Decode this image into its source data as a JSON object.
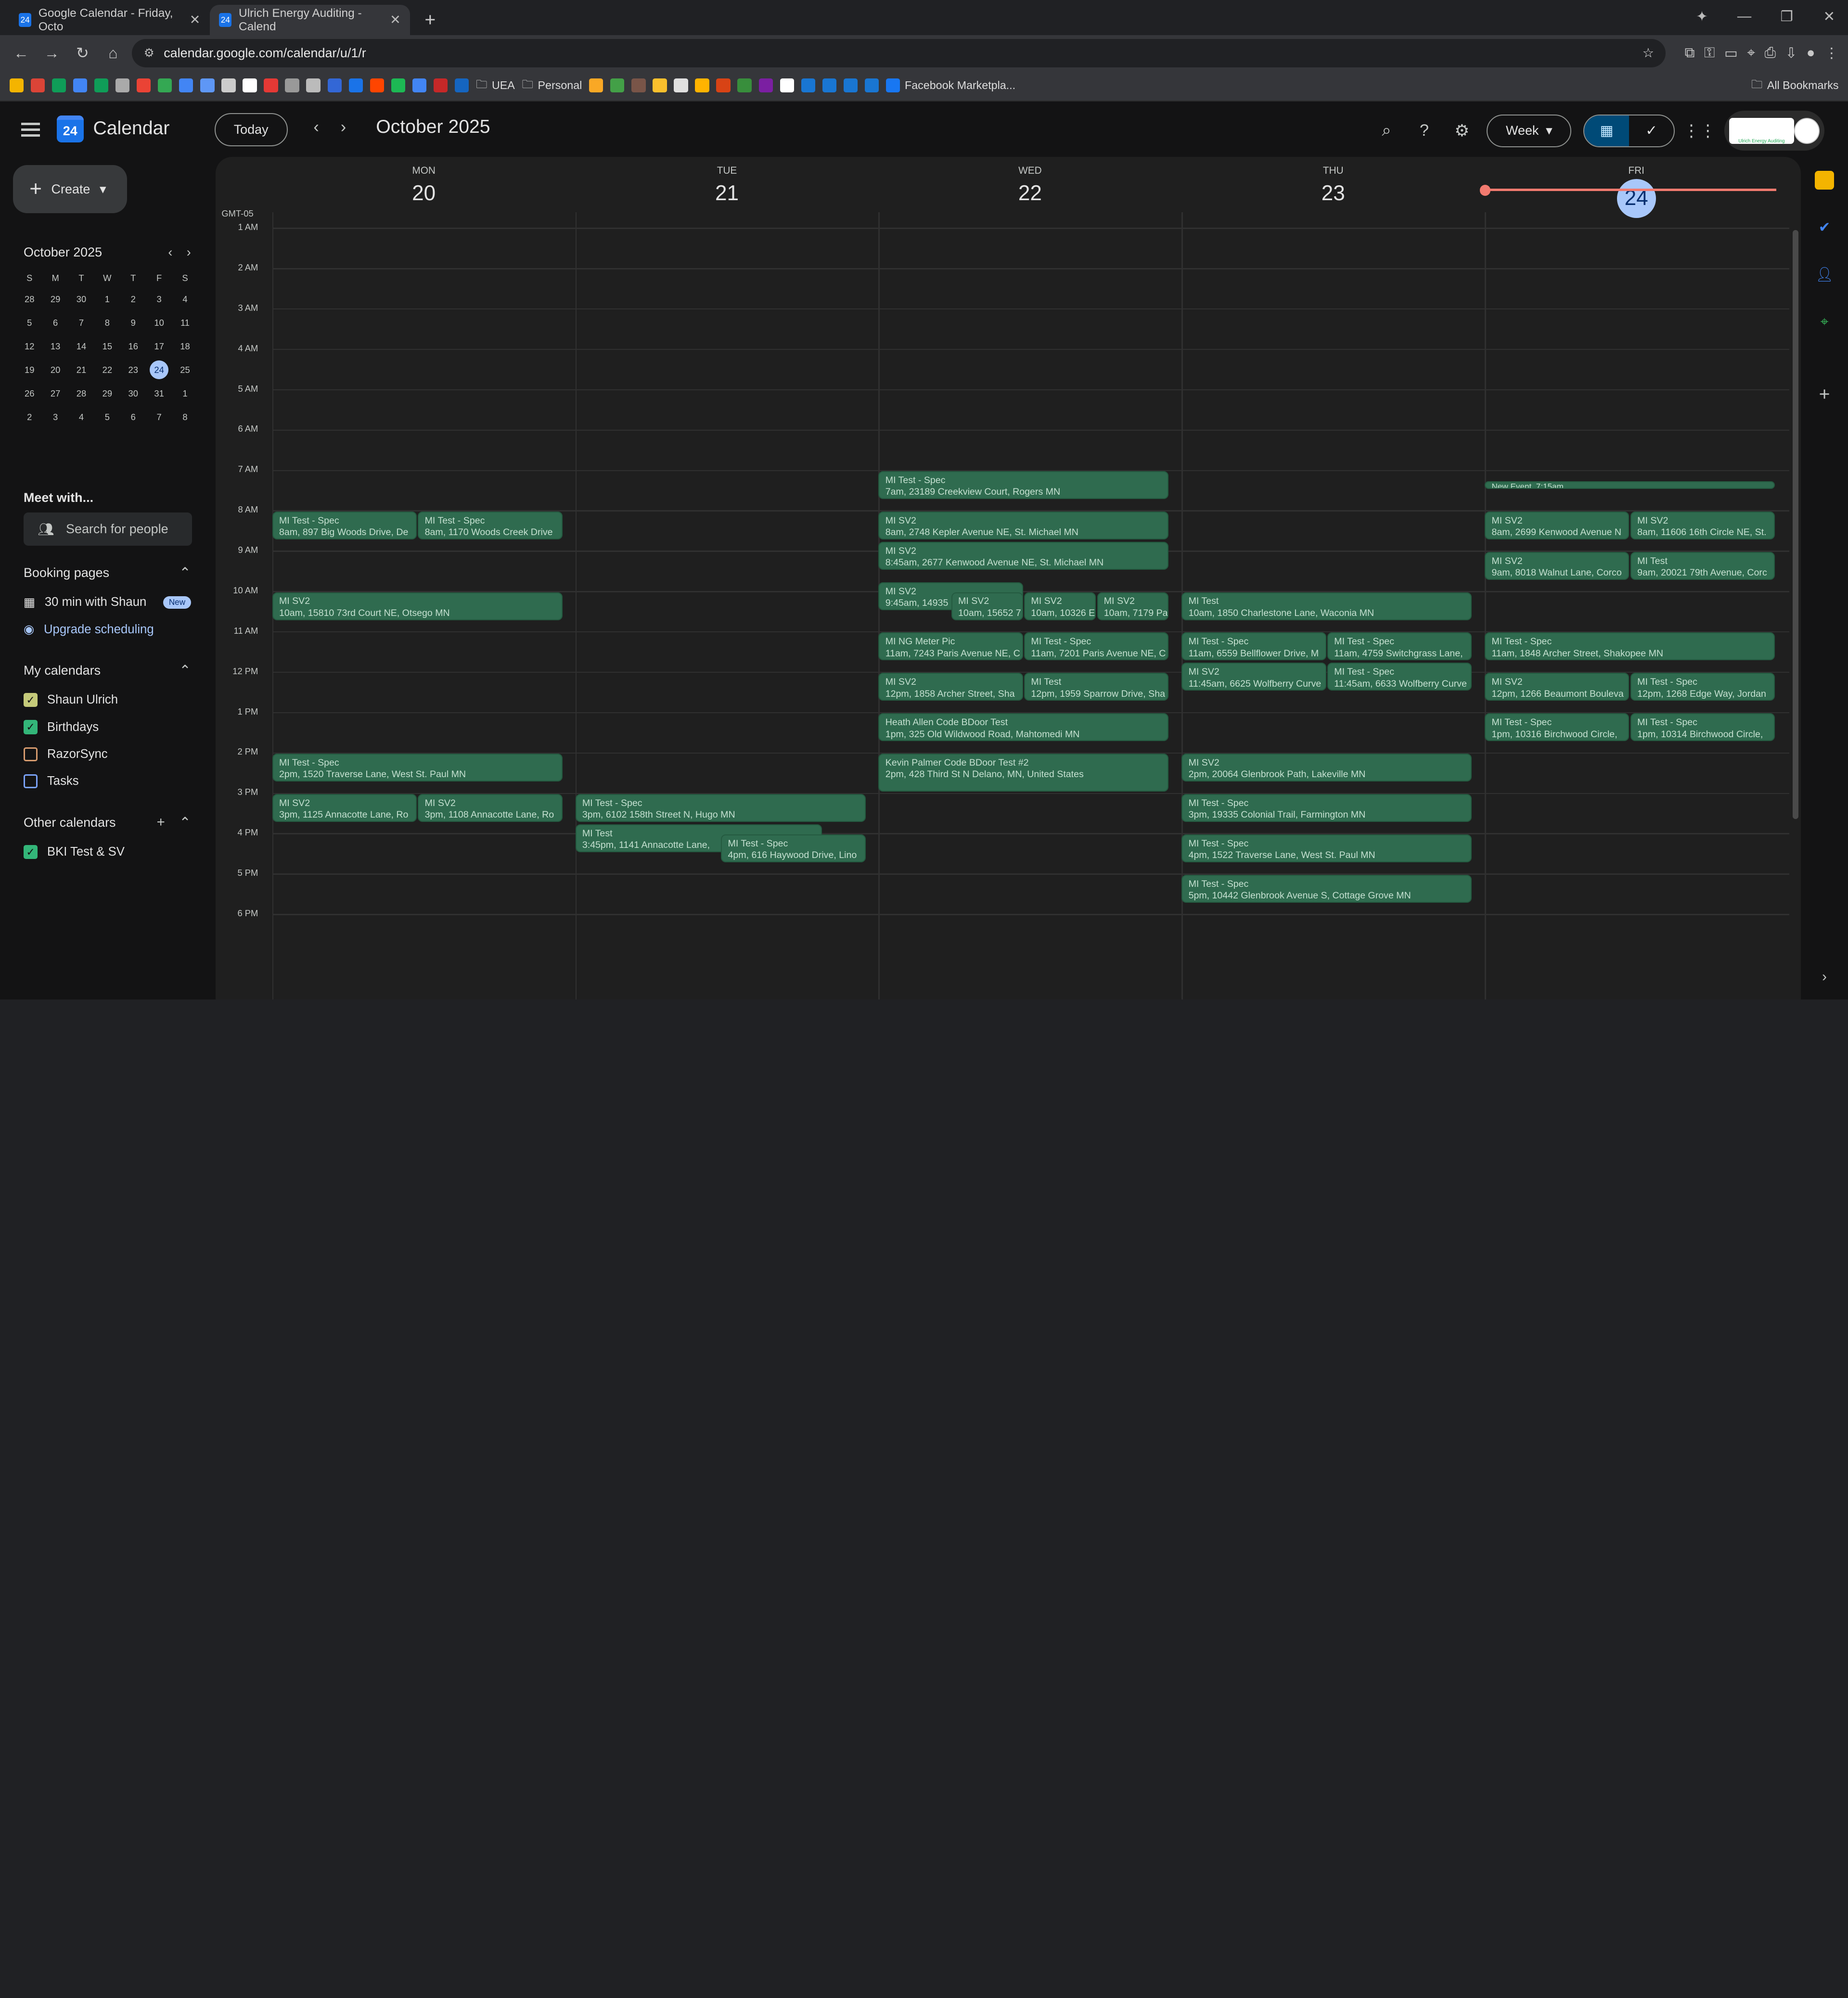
{
  "browser": {
    "tabs": [
      {
        "label": "Google Calendar - Friday, Octo",
        "active": false
      },
      {
        "label": "Ulrich Energy Auditing - Calend",
        "active": true
      }
    ],
    "url": "calendar.google.com/calendar/u/1/r",
    "bookmarks": [
      {
        "label": "UEA"
      },
      {
        "label": "Personal"
      },
      {
        "label": "Facebook Marketpla..."
      }
    ],
    "all_bookmarks": "All Bookmarks"
  },
  "app": {
    "title": "Calendar",
    "logo_text": "24",
    "today_label": "Today",
    "month_title": "October 2025",
    "view_label": "Week",
    "brand_logo_text": "Ulrich Energy Auditing"
  },
  "sidebar": {
    "create_label": "Create",
    "mini_month": "October 2025",
    "dow": [
      "S",
      "M",
      "T",
      "W",
      "T",
      "F",
      "S"
    ],
    "weeks": [
      [
        "28",
        "29",
        "30",
        "1",
        "2",
        "3",
        "4"
      ],
      [
        "5",
        "6",
        "7",
        "8",
        "9",
        "10",
        "11"
      ],
      [
        "12",
        "13",
        "14",
        "15",
        "16",
        "17",
        "18"
      ],
      [
        "19",
        "20",
        "21",
        "22",
        "23",
        "24",
        "25"
      ],
      [
        "26",
        "27",
        "28",
        "29",
        "30",
        "31",
        "1"
      ],
      [
        "2",
        "3",
        "4",
        "5",
        "6",
        "7",
        "8"
      ]
    ],
    "selected_day": "24",
    "meet_with": "Meet with...",
    "search_people": "Search for people",
    "booking_pages": "Booking pages",
    "booking_item": "30 min with Shaun",
    "new_badge": "New",
    "upgrade": "Upgrade scheduling",
    "my_calendars": "My calendars",
    "calendars": [
      {
        "label": "Shaun Ulrich",
        "checked": true,
        "color": "#c5ca7a"
      },
      {
        "label": "Birthdays",
        "checked": true,
        "color": "#33b679"
      },
      {
        "label": "RazorSync",
        "checked": false,
        "color": "#d79b6e"
      },
      {
        "label": "Tasks",
        "checked": false,
        "color": "#7aa2f7"
      }
    ],
    "other_calendars": "Other calendars",
    "others": [
      {
        "label": "BKI Test & SV",
        "checked": true,
        "color": "#33b679"
      }
    ]
  },
  "grid": {
    "timezone": "GMT-05",
    "days": [
      {
        "dow": "MON",
        "num": "20"
      },
      {
        "dow": "TUE",
        "num": "21"
      },
      {
        "dow": "WED",
        "num": "22"
      },
      {
        "dow": "THU",
        "num": "23"
      },
      {
        "dow": "FRI",
        "num": "24",
        "today": true
      }
    ],
    "hours": [
      "1 AM",
      "2 AM",
      "3 AM",
      "4 AM",
      "5 AM",
      "6 AM",
      "7 AM",
      "8 AM",
      "9 AM",
      "10 AM",
      "11 AM",
      "12 PM",
      "1 PM",
      "2 PM",
      "3 PM",
      "4 PM",
      "5 PM",
      "6 PM"
    ],
    "events": [
      {
        "day": 0,
        "start": 8,
        "dur": 0.75,
        "col": 0,
        "cols": 2,
        "title": "MI Test - Spec",
        "sub": "8am, 897 Big Woods Drive, De"
      },
      {
        "day": 0,
        "start": 8,
        "dur": 0.75,
        "col": 1,
        "cols": 2,
        "title": "MI Test - Spec",
        "sub": "8am, 1170 Woods Creek Drive"
      },
      {
        "day": 0,
        "start": 10,
        "dur": 0.75,
        "col": 0,
        "cols": 1,
        "title": "MI SV2",
        "sub": "10am, 15810 73rd Court NE, Otsego MN"
      },
      {
        "day": 0,
        "start": 14,
        "dur": 0.75,
        "col": 0,
        "cols": 1,
        "title": "MI Test - Spec",
        "sub": "2pm, 1520 Traverse Lane, West St. Paul MN"
      },
      {
        "day": 0,
        "start": 15,
        "dur": 0.75,
        "col": 0,
        "cols": 2,
        "title": "MI SV2",
        "sub": "3pm, 1125 Annacotte Lane, Ro"
      },
      {
        "day": 0,
        "start": 15,
        "dur": 0.75,
        "col": 1,
        "cols": 2,
        "title": "MI SV2",
        "sub": "3pm, 1108 Annacotte Lane, Ro"
      },
      {
        "day": 1,
        "start": 15,
        "dur": 0.75,
        "col": 0,
        "cols": 1,
        "title": "MI Test - Spec",
        "sub": "3pm, 6102 158th Street N, Hugo MN"
      },
      {
        "day": 1,
        "start": 15.75,
        "dur": 0.75,
        "col": 0,
        "cols": 1,
        "w": 0.85,
        "title": "MI Test",
        "sub": "3:45pm, 1141 Annacotte Lane,"
      },
      {
        "day": 1,
        "start": 16,
        "dur": 0.75,
        "col": 1,
        "cols": 2,
        "title": "MI Test - Spec",
        "sub": "4pm, 616 Haywood Drive, Lino"
      },
      {
        "day": 2,
        "start": 7,
        "dur": 0.75,
        "col": 0,
        "cols": 1,
        "title": "MI Test - Spec",
        "sub": "7am, 23189 Creekview Court, Rogers MN"
      },
      {
        "day": 2,
        "start": 8,
        "dur": 0.75,
        "col": 0,
        "cols": 1,
        "title": "MI SV2",
        "sub": "8am, 2748 Kepler Avenue NE, St. Michael MN"
      },
      {
        "day": 2,
        "start": 8.75,
        "dur": 0.75,
        "col": 0,
        "cols": 1,
        "title": "MI SV2",
        "sub": "8:45am, 2677 Kenwood Avenue NE, St. Michael MN"
      },
      {
        "day": 2,
        "start": 9.75,
        "dur": 0.75,
        "col": 0,
        "cols": 2,
        "title": "MI SV2",
        "sub": "9:45am, 14935"
      },
      {
        "day": 2,
        "start": 10,
        "dur": 0.75,
        "col": 1,
        "cols": 4,
        "title": "MI SV2",
        "sub": "10am, 15652 7"
      },
      {
        "day": 2,
        "start": 10,
        "dur": 0.75,
        "col": 2,
        "cols": 4,
        "title": "MI SV2",
        "sub": "10am, 10326 E"
      },
      {
        "day": 2,
        "start": 10,
        "dur": 0.75,
        "col": 3,
        "cols": 4,
        "title": "MI SV2",
        "sub": "10am, 7179 Pa"
      },
      {
        "day": 2,
        "start": 11,
        "dur": 0.75,
        "col": 0,
        "cols": 2,
        "title": "MI NG Meter Pic",
        "sub": "11am, 7243 Paris Avenue NE, C"
      },
      {
        "day": 2,
        "start": 11,
        "dur": 0.75,
        "col": 1,
        "cols": 2,
        "title": "MI Test - Spec",
        "sub": "11am, 7201 Paris Avenue NE, C"
      },
      {
        "day": 2,
        "start": 12,
        "dur": 0.75,
        "col": 0,
        "cols": 2,
        "title": "MI SV2",
        "sub": "12pm, 1858 Archer Street, Sha"
      },
      {
        "day": 2,
        "start": 12,
        "dur": 0.75,
        "col": 1,
        "cols": 2,
        "title": "MI Test",
        "sub": "12pm, 1959 Sparrow Drive, Sha"
      },
      {
        "day": 2,
        "start": 13,
        "dur": 0.75,
        "col": 0,
        "cols": 1,
        "title": "Heath Allen Code BDoor Test",
        "sub": "1pm, 325 Old Wildwood Road, Mahtomedi MN"
      },
      {
        "day": 2,
        "start": 14,
        "dur": 1,
        "col": 0,
        "cols": 1,
        "title": "Kevin Palmer Code BDoor Test #2",
        "sub": "2pm, 428 Third St N Delano, MN, United States"
      },
      {
        "day": 3,
        "start": 10,
        "dur": 0.75,
        "col": 0,
        "cols": 1,
        "title": "MI Test",
        "sub": "10am, 1850 Charlestone Lane, Waconia MN"
      },
      {
        "day": 3,
        "start": 11,
        "dur": 0.75,
        "col": 0,
        "cols": 2,
        "title": "MI Test - Spec",
        "sub": "11am, 6559 Bellflower Drive, M"
      },
      {
        "day": 3,
        "start": 11,
        "dur": 0.75,
        "col": 1,
        "cols": 2,
        "title": "MI Test - Spec",
        "sub": "11am, 4759 Switchgrass Lane,"
      },
      {
        "day": 3,
        "start": 11.75,
        "dur": 0.75,
        "col": 0,
        "cols": 2,
        "title": "MI SV2",
        "sub": "11:45am, 6625 Wolfberry Curve"
      },
      {
        "day": 3,
        "start": 11.75,
        "dur": 0.75,
        "col": 1,
        "cols": 2,
        "title": "MI Test - Spec",
        "sub": "11:45am, 6633 Wolfberry Curve"
      },
      {
        "day": 3,
        "start": 14,
        "dur": 0.75,
        "col": 0,
        "cols": 1,
        "title": "MI SV2",
        "sub": "2pm, 20064 Glenbrook Path, Lakeville MN"
      },
      {
        "day": 3,
        "start": 15,
        "dur": 0.75,
        "col": 0,
        "cols": 1,
        "title": "MI Test - Spec",
        "sub": "3pm, 19335 Colonial Trail, Farmington MN"
      },
      {
        "day": 3,
        "start": 16,
        "dur": 0.75,
        "col": 0,
        "cols": 1,
        "title": "MI Test - Spec",
        "sub": "4pm, 1522 Traverse Lane, West St. Paul MN"
      },
      {
        "day": 3,
        "start": 17,
        "dur": 0.75,
        "col": 0,
        "cols": 1,
        "title": "MI Test - Spec",
        "sub": "5pm, 10442 Glenbrook Avenue S, Cottage Grove MN"
      },
      {
        "day": 4,
        "start": 7.25,
        "dur": 0.25,
        "col": 0,
        "cols": 1,
        "thin": true,
        "title": "New Event, 7:15am",
        "sub": ""
      },
      {
        "day": 4,
        "start": 8,
        "dur": 0.75,
        "col": 0,
        "cols": 2,
        "title": "MI SV2",
        "sub": "8am, 2699 Kenwood Avenue N"
      },
      {
        "day": 4,
        "start": 8,
        "dur": 0.75,
        "col": 1,
        "cols": 2,
        "title": "MI SV2",
        "sub": "8am, 11606 16th Circle NE, St."
      },
      {
        "day": 4,
        "start": 9,
        "dur": 0.75,
        "col": 0,
        "cols": 2,
        "title": "MI SV2",
        "sub": "9am, 8018 Walnut Lane, Corco"
      },
      {
        "day": 4,
        "start": 9,
        "dur": 0.75,
        "col": 1,
        "cols": 2,
        "title": "MI Test",
        "sub": "9am, 20021 79th Avenue, Corc"
      },
      {
        "day": 4,
        "start": 11,
        "dur": 0.75,
        "col": 0,
        "cols": 1,
        "title": "MI Test - Spec",
        "sub": "11am, 1848 Archer Street, Shakopee MN"
      },
      {
        "day": 4,
        "start": 12,
        "dur": 0.75,
        "col": 0,
        "cols": 2,
        "title": "MI SV2",
        "sub": "12pm, 1266 Beaumont Bouleva"
      },
      {
        "day": 4,
        "start": 12,
        "dur": 0.75,
        "col": 1,
        "cols": 2,
        "title": "MI Test - Spec",
        "sub": "12pm, 1268 Edge Way, Jordan"
      },
      {
        "day": 4,
        "start": 13,
        "dur": 0.75,
        "col": 0,
        "cols": 2,
        "title": "MI Test - Spec",
        "sub": "1pm, 10316 Birchwood Circle,"
      },
      {
        "day": 4,
        "start": 13,
        "dur": 0.75,
        "col": 1,
        "cols": 2,
        "title": "MI Test - Spec",
        "sub": "1pm, 10314 Birchwood Circle,"
      }
    ]
  }
}
